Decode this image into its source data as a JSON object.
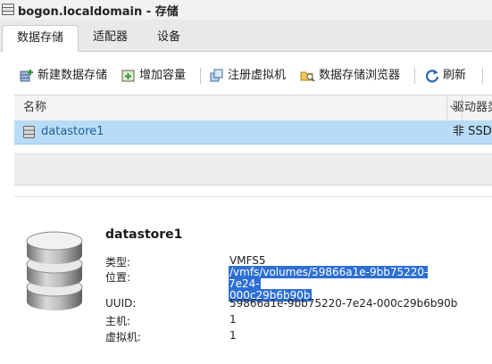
{
  "window": {
    "title": "bogon.localdomain - 存储"
  },
  "tabs": [
    {
      "label": "数据存储",
      "active": true
    },
    {
      "label": "适配器",
      "active": false
    },
    {
      "label": "设备",
      "active": false
    }
  ],
  "toolbar": {
    "new_datastore": "新建数据存储",
    "increase_capacity": "增加容量",
    "register_vm": "注册虚拟机",
    "datastore_browser": "数据存储浏览器",
    "refresh": "刷新"
  },
  "table": {
    "columns": [
      "名称",
      "驱动器类"
    ],
    "rows": [
      {
        "name": "datastore1",
        "drive_type": "非 SSD"
      }
    ]
  },
  "details": {
    "name": "datastore1",
    "type_label": "类型:",
    "type_value": "VMFS5",
    "location_label": "位置:",
    "location_line1": "/vmfs/volumes/59866a1e-9bb75220-7e24-",
    "location_line2": "000c29b6b90b",
    "uuid_label": "UUID:",
    "uuid_value": "59866a1e-9bb75220-7e24-000c29b6b90b",
    "host_label": "主机:",
    "host_value": "1",
    "vm_label": "虚拟机:",
    "vm_value": "1"
  },
  "colors": {
    "selected_row": "#b8dcf5",
    "link_text": "#1f5e9a",
    "text_selection": "#2e6fd6"
  },
  "icons": {
    "window": "storage-window-icon",
    "new_datastore": "new-datastore-icon",
    "increase_capacity": "increase-capacity-icon",
    "register_vm": "register-vm-icon",
    "datastore_browser": "folder-search-icon",
    "refresh": "refresh-icon",
    "sort": "chevron-down-icon",
    "datastore_row": "datastore-icon",
    "datastore_large": "disk-stack-icon"
  }
}
